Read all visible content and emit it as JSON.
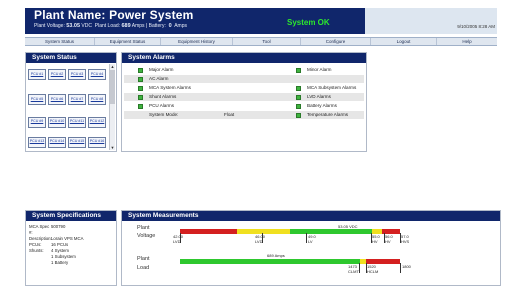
{
  "header": {
    "plant_name_label": "Plant Name:",
    "plant_name": "Power System",
    "voltage_label": "Plant Voltage:",
    "voltage_value": "53.05",
    "voltage_unit": "VDC",
    "load_label": "Plant Load:",
    "load_value": "689",
    "load_unit": "Amps",
    "battery_label": "Battery:",
    "battery_value": "0",
    "battery_unit": "Amps",
    "status": "System OK",
    "datetime": "9/10/2005 8:28 AM"
  },
  "nav": {
    "items": [
      "System Status",
      "Equipment Status",
      "Equipment History",
      "Tool",
      "Configure",
      "Logout",
      "Help"
    ]
  },
  "system_status": {
    "title": "System Status",
    "pcus": [
      "PCU #1",
      "PCU #2",
      "PCU #3",
      "PCU #4",
      "PCU #5",
      "PCU #6",
      "PCU #7",
      "PCU #8",
      "PCU #9",
      "PCU #10",
      "PCU #11",
      "PCU #12",
      "PCU #13",
      "PCU #14",
      "PCU #15",
      "PCU #16"
    ]
  },
  "system_alarms": {
    "title": "System Alarms",
    "left": [
      "Major Alarm",
      "AC Alarm",
      "MCA System Alarms",
      "Shunt Alarms",
      "PCU Alarms"
    ],
    "right": [
      "Minor Alarm",
      "",
      "MCA Subsystem Alarms",
      "LVD Alarms",
      "Battery Alarms"
    ],
    "mode_label": "System Mode:",
    "mode_value": "Float",
    "temp_label": "Temperature Alarms",
    "colors": {
      "ok": "#3fb43f"
    }
  },
  "specs": {
    "title": "System Specifications",
    "rows": [
      {
        "key": "MCA Spec #:",
        "val": "500790"
      },
      {
        "key": "Description:",
        "val": "Lorain VPS MCA"
      },
      {
        "key": "PCUs:",
        "val": "16 PCUs"
      },
      {
        "key": "Shunts:",
        "val": "4 System"
      },
      {
        "key": "",
        "val": "1 Subsystem"
      },
      {
        "key": "",
        "val": "1 Battery"
      }
    ]
  },
  "measurements": {
    "title": "System Measurements",
    "voltage_label_1": "Plant",
    "voltage_label_2": "Voltage",
    "load_label_1": "Plant",
    "load_label_2": "Load",
    "voltage_value_text": "53.05 VDC",
    "load_value_text": "689 Amps",
    "voltage_ticks": [
      {
        "v": "42.00",
        "c": "LVD"
      },
      {
        "v": "46.00",
        "c": "LVD"
      },
      {
        "v": "49.0",
        "c": "LV"
      },
      {
        "v": "55.0",
        "c": "HV"
      },
      {
        "v": "56.0",
        "c": "HV"
      },
      {
        "v": "57.0",
        "c": "HVS"
      }
    ],
    "load_ticks": [
      {
        "v": "1473",
        "c": "CLMT"
      },
      {
        "v": "1520",
        "c": "HCLM"
      },
      {
        "v": "1800",
        "c": ""
      }
    ],
    "colors": {
      "red": "#d42020",
      "yellow": "#f0e020",
      "green": "#2ec82e"
    }
  }
}
